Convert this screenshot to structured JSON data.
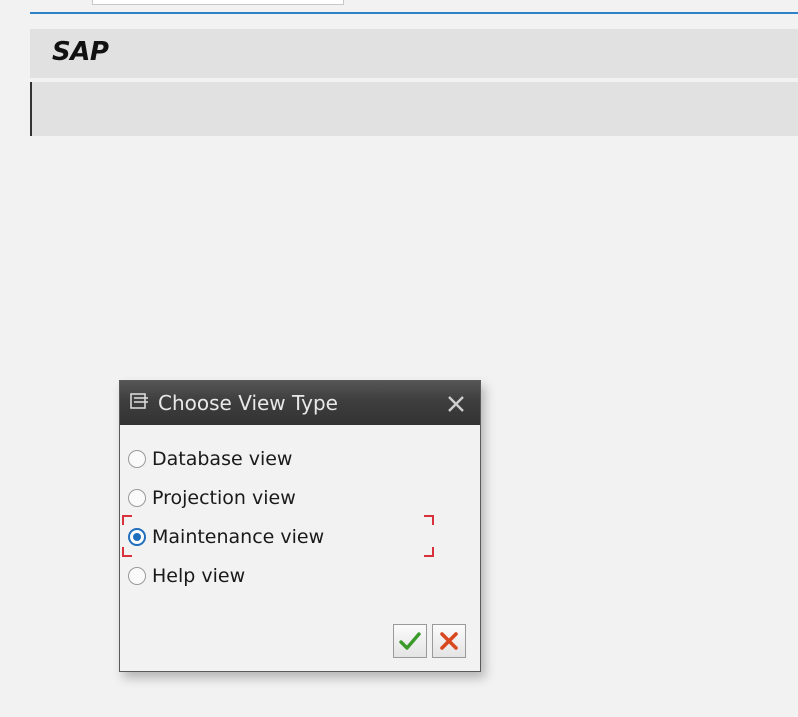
{
  "app": {
    "title": "SAP"
  },
  "dialog": {
    "title": "Choose View Type",
    "options": [
      {
        "label": "Database view",
        "checked": false
      },
      {
        "label": "Projection view",
        "checked": false
      },
      {
        "label": "Maintenance view",
        "checked": true
      },
      {
        "label": "Help view",
        "checked": false
      }
    ],
    "icons": {
      "header": "dialog-window-icon",
      "close": "close-icon",
      "confirm": "checkmark-icon",
      "cancel": "cancel-x-icon"
    }
  },
  "colors": {
    "accent_line": "#2e83c8",
    "radio_selected": "#1f6fbf",
    "focus_corners": "#d8323c",
    "confirm_green": "#3a9a2a",
    "cancel_red": "#d9481f"
  }
}
